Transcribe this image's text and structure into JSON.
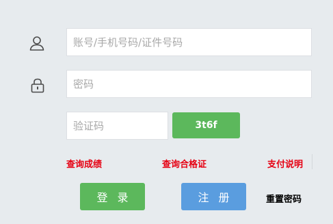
{
  "form": {
    "account_placeholder": "账号/手机号码/证件号码",
    "password_placeholder": "密码",
    "captcha_placeholder": "验证码",
    "captcha_code": "3t6f"
  },
  "links": {
    "query_score": "查询成绩",
    "query_certificate": "查询合格证",
    "payment_info": "支付说明",
    "reset_password": "重置密码"
  },
  "buttons": {
    "login": "登录",
    "register": "注册"
  },
  "icons": {
    "account": "user-icon",
    "password": "lock-icon"
  },
  "colors": {
    "background": "#e7ebee",
    "green": "#5cb85c",
    "blue": "#5a9ddf",
    "red_link": "#e60012"
  }
}
